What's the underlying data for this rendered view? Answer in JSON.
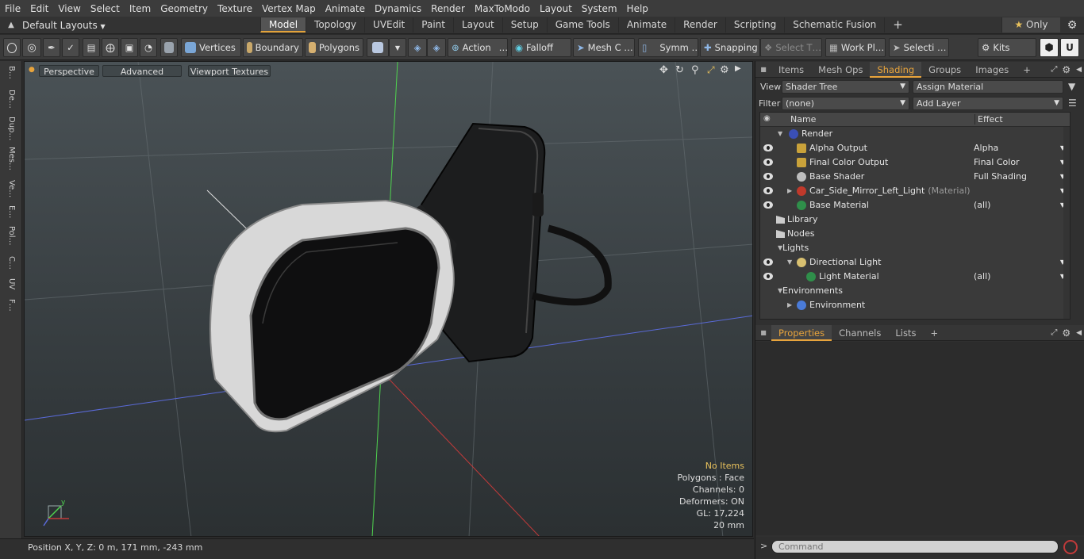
{
  "menu": [
    "File",
    "Edit",
    "View",
    "Select",
    "Item",
    "Geometry",
    "Texture",
    "Vertex Map",
    "Animate",
    "Dynamics",
    "Render",
    "MaxToModo",
    "Layout",
    "System",
    "Help"
  ],
  "layoutbar": {
    "layout_select": "Default Layouts",
    "tabs": [
      "Model",
      "Topology",
      "UVEdit",
      "Paint",
      "Layout",
      "Setup",
      "Game Tools",
      "Animate",
      "Render",
      "Scripting",
      "Schematic Fusion"
    ],
    "active_tab": "Model",
    "add": "+",
    "only_label": "Only"
  },
  "toolbar": {
    "vertices": "Vertices",
    "boundary": "Boundary",
    "polygons": "Polygons",
    "action": "Action",
    "action_more": "…",
    "falloff": "Falloff",
    "meshc": "Mesh C …",
    "symm": "Symm …",
    "snapping": "Snapping",
    "select_t": "Select T…",
    "workpl": "Work Pl…",
    "selecti": "Selecti …",
    "kits": "Kits"
  },
  "leftstrip": [
    "B…",
    "De…",
    "Dup…",
    "Mes…",
    "Ve…",
    "E…",
    "Pol…",
    "C…",
    "UV",
    "F…"
  ],
  "viewport": {
    "perspective": "Perspective",
    "advanced": "Advanced",
    "textures": "Viewport Textures",
    "stats": {
      "no_items": "No Items",
      "polygons": "Polygons : Face",
      "channels": "Channels: 0",
      "deformers": "Deformers: ON",
      "gl": "GL: 17,224",
      "size": "20 mm"
    }
  },
  "status": {
    "position": "Position X, Y, Z:   0 m, 171 mm, -243 mm"
  },
  "panel_top": {
    "tabs": [
      "Items",
      "Mesh Ops",
      "Shading",
      "Groups",
      "Images"
    ],
    "active": "Shading",
    "view_label": "View",
    "view_value": "Shader Tree",
    "assign": "Assign Material",
    "filter_label": "Filter",
    "filter_value": "(none)",
    "add_layer": "Add Layer",
    "col_name": "Name",
    "col_effect": "Effect",
    "rows": [
      {
        "label": "Render",
        "effect": "",
        "sub": ""
      },
      {
        "label": "Alpha Output",
        "effect": "Alpha",
        "sub": ""
      },
      {
        "label": "Final Color Output",
        "effect": "Final Color",
        "sub": ""
      },
      {
        "label": "Base Shader",
        "effect": "Full Shading",
        "sub": ""
      },
      {
        "label": "Car_Side_Mirror_Left_Light",
        "effect": "",
        "sub": "(Material)"
      },
      {
        "label": "Base Material",
        "effect": "(all)",
        "sub": ""
      },
      {
        "label": "Library",
        "effect": "",
        "sub": ""
      },
      {
        "label": "Nodes",
        "effect": "",
        "sub": ""
      },
      {
        "label": "Lights",
        "effect": "",
        "sub": ""
      },
      {
        "label": "Directional Light",
        "effect": "",
        "sub": ""
      },
      {
        "label": "Light Material",
        "effect": "(all)",
        "sub": ""
      },
      {
        "label": "Environments",
        "effect": "",
        "sub": ""
      },
      {
        "label": "Environment",
        "effect": "",
        "sub": ""
      }
    ]
  },
  "panel_bottom": {
    "tabs": [
      "Properties",
      "Channels",
      "Lists"
    ],
    "active": "Properties"
  },
  "command": {
    "prompt": ">",
    "placeholder": "Command"
  },
  "colors": {
    "accent": "#e8a43c",
    "highlight": "#e8c15c"
  }
}
